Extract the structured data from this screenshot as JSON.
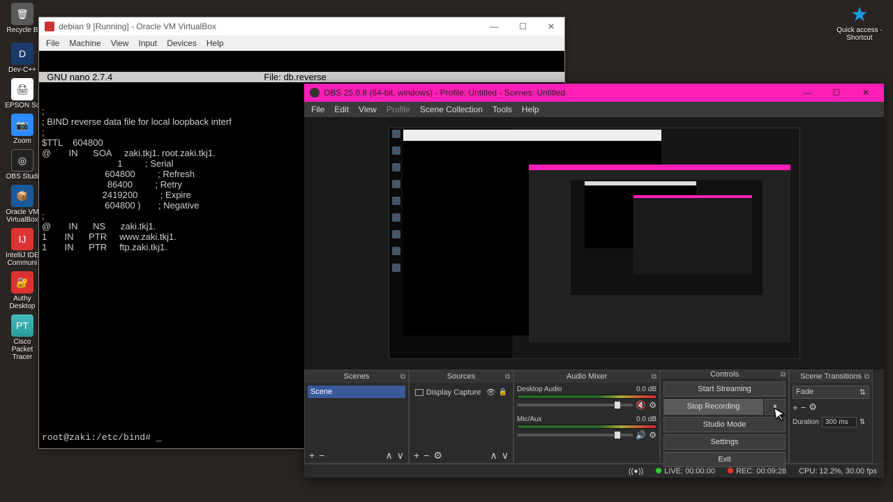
{
  "desktop": {
    "left": [
      {
        "label": "Recycle B"
      },
      {
        "label": "Dev-C++"
      },
      {
        "label": "EPSON Sc"
      },
      {
        "label": "Zoom"
      },
      {
        "label": "OBS Studi"
      },
      {
        "label": "Oracle VM VirtualBox"
      },
      {
        "label": "IntelliJ IDE Communi"
      },
      {
        "label": "Authy Desktop"
      },
      {
        "label": "Cisco Packet Tracer"
      }
    ],
    "right": {
      "label": "Quick access - Shortcut"
    }
  },
  "vbox": {
    "title": "debian 9 [Running] - Oracle VM VirtualBox",
    "menu": [
      "File",
      "Machine",
      "View",
      "Input",
      "Devices",
      "Help"
    ],
    "nano_left": "  GNU nano 2.7.4",
    "nano_file": "File: db.reverse",
    "body": ";\n; BIND reverse data file for local loopback interf\n;\n$TTL    604800\n@       IN      SOA     zaki.tkj1. root.zaki.tkj1.\n                              1         ; Serial\n                         604800         ; Refresh\n                          86400         ; Retry\n                        2419200         ; Expire\n                         604800 )       ; Negative\n;\n@       IN      NS      zaki.tkj1.\n1       IN      PTR     www.zaki.tkj1.\n1       IN      PTR     ftp.zaki.tkj1.\n",
    "prompt": "root@zaki:/etc/bind# _"
  },
  "obs": {
    "title": "OBS 25.0.8 (64-bit, windows) - Profile: Untitled - Scenes: Untitled",
    "menu": [
      "File",
      "Edit",
      "View",
      "Profile",
      "Scene Collection",
      "Tools",
      "Help"
    ],
    "panels": {
      "scenes": {
        "title": "Scenes",
        "items": [
          "Scene"
        ]
      },
      "sources": {
        "title": "Sources",
        "items": [
          "Display Capture"
        ]
      },
      "mixer": {
        "title": "Audio Mixer",
        "channels": [
          {
            "name": "Desktop Audio",
            "db": "0.0 dB",
            "muted": true
          },
          {
            "name": "Mic/Aux",
            "db": "0.0 dB",
            "muted": false
          }
        ]
      },
      "controls": {
        "title": "Controls",
        "buttons": {
          "start_streaming": "Start Streaming",
          "stop_recording": "Stop Recording",
          "pause": "⏸",
          "studio": "Studio Mode",
          "settings": "Settings",
          "exit": "Exit"
        }
      },
      "transitions": {
        "title": "Scene Transitions",
        "selected": "Fade",
        "duration_label": "Duration",
        "duration_value": "300 ms"
      }
    },
    "status": {
      "live": "LIVE: 00:00:00",
      "rec": "REC: 00:09:28",
      "cpu": "CPU: 12.2%, 30.00 fps"
    }
  }
}
